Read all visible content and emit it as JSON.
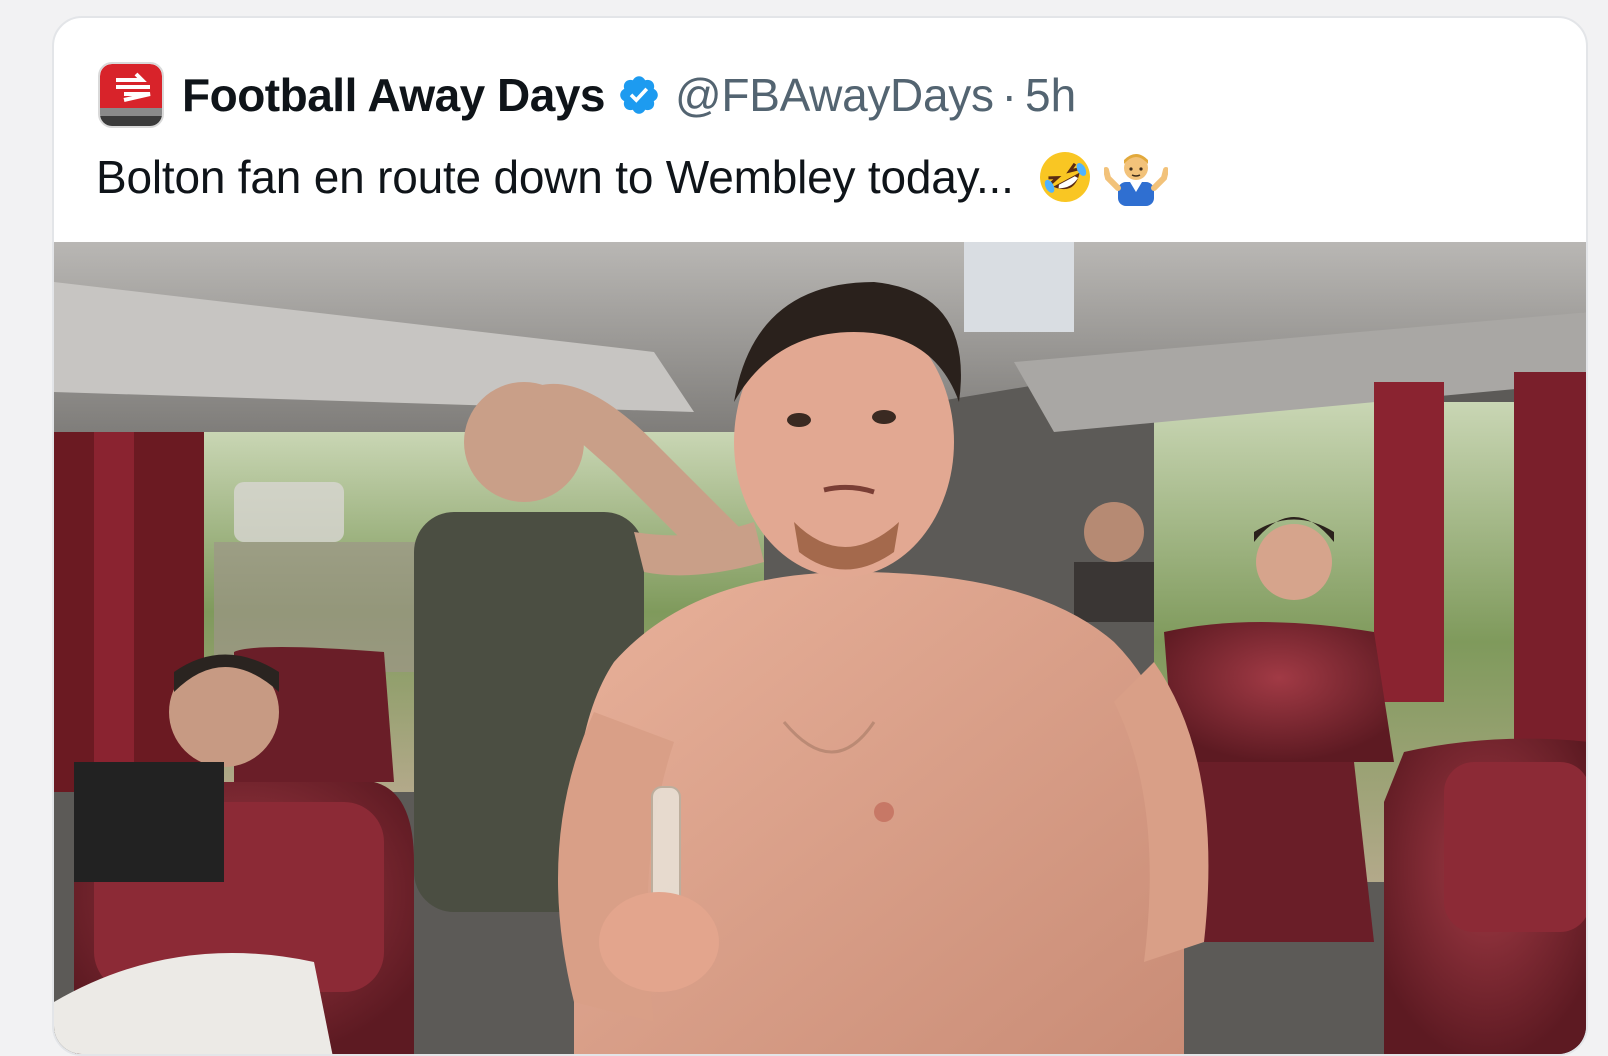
{
  "tweet": {
    "author_name": "Football Away Days",
    "handle": "@FBAwayDays",
    "separator": "·",
    "time": "5h",
    "text": "Bolton fan en route down to Wembley today...",
    "emojis": [
      "rolling-on-floor-laughing-emoji",
      "man-shrugging-emoji"
    ],
    "avatar_icon": "national-rail-logo-icon",
    "verified_icon": "verified-badge-icon",
    "image_alt": "Shirtless man holding a bottle on a coach bus"
  },
  "colors": {
    "name": "#0f1419",
    "secondary": "#536471",
    "verified": "#1d9bf0",
    "rail_red": "#d8232a",
    "seat_red": "#7a1f2b"
  }
}
